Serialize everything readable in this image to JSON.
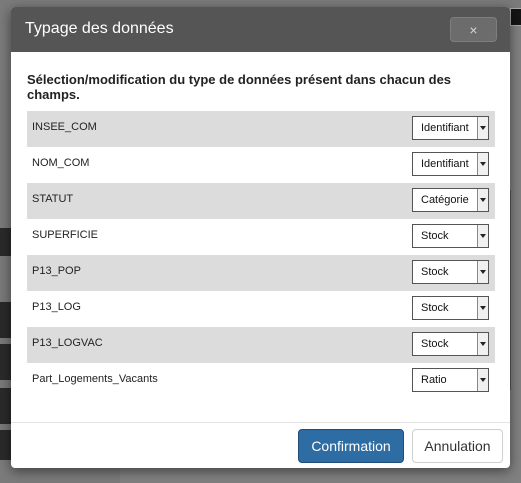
{
  "modal": {
    "title": "Typage des données",
    "close_label": "×",
    "intro": "Sélection/modification du type de données présent dans chacun des champs.",
    "fields": [
      {
        "name": "INSEE_COM",
        "type": "Identifiant"
      },
      {
        "name": "NOM_COM",
        "type": "Identifiant"
      },
      {
        "name": "STATUT",
        "type": "Catégorie"
      },
      {
        "name": "SUPERFICIE",
        "type": "Stock"
      },
      {
        "name": "P13_POP",
        "type": "Stock"
      },
      {
        "name": "P13_LOG",
        "type": "Stock"
      },
      {
        "name": "P13_LOGVAC",
        "type": "Stock"
      },
      {
        "name": "Part_Logements_Vacants",
        "type": "Ratio"
      }
    ],
    "confirm_label": "Confirmation",
    "cancel_label": "Annulation"
  },
  "colors": {
    "header": "#555555",
    "primary": "#2e6ca4",
    "row_shade": "#dcdcdc"
  }
}
